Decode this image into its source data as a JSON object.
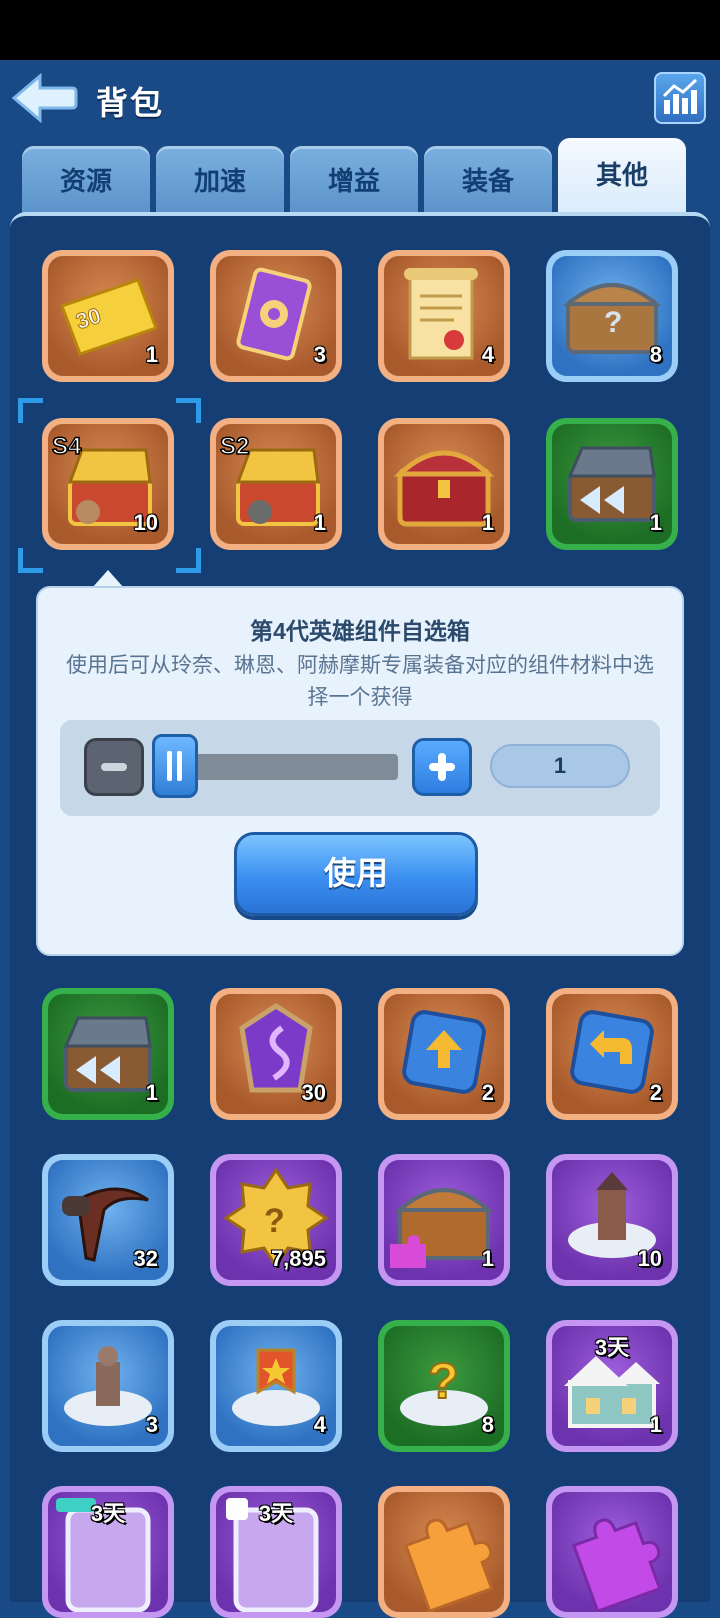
{
  "header": {
    "title": "背包"
  },
  "tabs": [
    {
      "label": "资源",
      "active": false
    },
    {
      "label": "加速",
      "active": false
    },
    {
      "label": "增益",
      "active": false
    },
    {
      "label": "装备",
      "active": false
    },
    {
      "label": "其他",
      "active": true
    }
  ],
  "items_row1": [
    {
      "icon": "ticket-30-icon",
      "badge": "30",
      "count": "1",
      "frame": "orange"
    },
    {
      "icon": "purple-card-icon",
      "count": "3",
      "frame": "orange"
    },
    {
      "icon": "scroll-icon",
      "count": "4",
      "frame": "orange"
    },
    {
      "icon": "mystery-chest-icon",
      "count": "8",
      "frame": "blue"
    }
  ],
  "items_row2": [
    {
      "icon": "s4-hero-chest-icon",
      "label": "S4",
      "count": "10",
      "frame": "orange",
      "selected": true
    },
    {
      "icon": "s2-hero-chest-icon",
      "label": "S2",
      "count": "1",
      "frame": "orange"
    },
    {
      "icon": "red-treasure-chest-icon",
      "count": "1",
      "frame": "orange"
    },
    {
      "icon": "rank-chest-icon",
      "count": "1",
      "frame": "green"
    }
  ],
  "tooltip": {
    "title": "第4代英雄组件自选箱",
    "description": "使用后可从玲奈、琳恩、阿赫摩斯专属装备对应的组件材料中选择一个获得",
    "quantity": "1",
    "slider_fraction": 0.0,
    "use_label": "使用"
  },
  "items_row3": [
    {
      "icon": "rank-chest-icon",
      "count": "1",
      "frame": "green"
    },
    {
      "icon": "purple-rune-icon",
      "count": "30",
      "frame": "orange"
    },
    {
      "icon": "upload-arrow-icon",
      "count": "2",
      "frame": "orange"
    },
    {
      "icon": "return-arrow-icon",
      "count": "2",
      "frame": "orange"
    }
  ],
  "items_row4": [
    {
      "icon": "scythe-weapon-icon",
      "count": "32",
      "frame": "blue"
    },
    {
      "icon": "gold-mystery-badge-icon",
      "count": "7,895",
      "frame": "purple"
    },
    {
      "icon": "puzzle-chest-icon",
      "count": "1",
      "frame": "purple"
    },
    {
      "icon": "tower-decoration-icon",
      "count": "10",
      "frame": "purple"
    }
  ],
  "items_row5": [
    {
      "icon": "statue-decoration-icon",
      "count": "3",
      "frame": "blue"
    },
    {
      "icon": "banner-decoration-icon",
      "count": "4",
      "frame": "blue"
    },
    {
      "icon": "random-decoration-icon",
      "count": "8",
      "frame": "green"
    },
    {
      "icon": "gingerbread-house-icon",
      "count": "1",
      "timer": "3天",
      "frame": "purple"
    }
  ],
  "items_row6": [
    {
      "icon": "taptap-frame-icon",
      "timer": "3天",
      "frame": "purple"
    },
    {
      "icon": "avatar-frame-icon",
      "timer": "3天",
      "frame": "purple"
    },
    {
      "icon": "orange-puzzle-piece-icon",
      "frame": "orange"
    },
    {
      "icon": "purple-puzzle-piece-icon",
      "frame": "purple"
    }
  ],
  "colors": {
    "background": "#1a4a86",
    "panel": "#153e75",
    "tooltip_bg": "#e8f2fc",
    "button_blue": "#3a8ff0"
  }
}
